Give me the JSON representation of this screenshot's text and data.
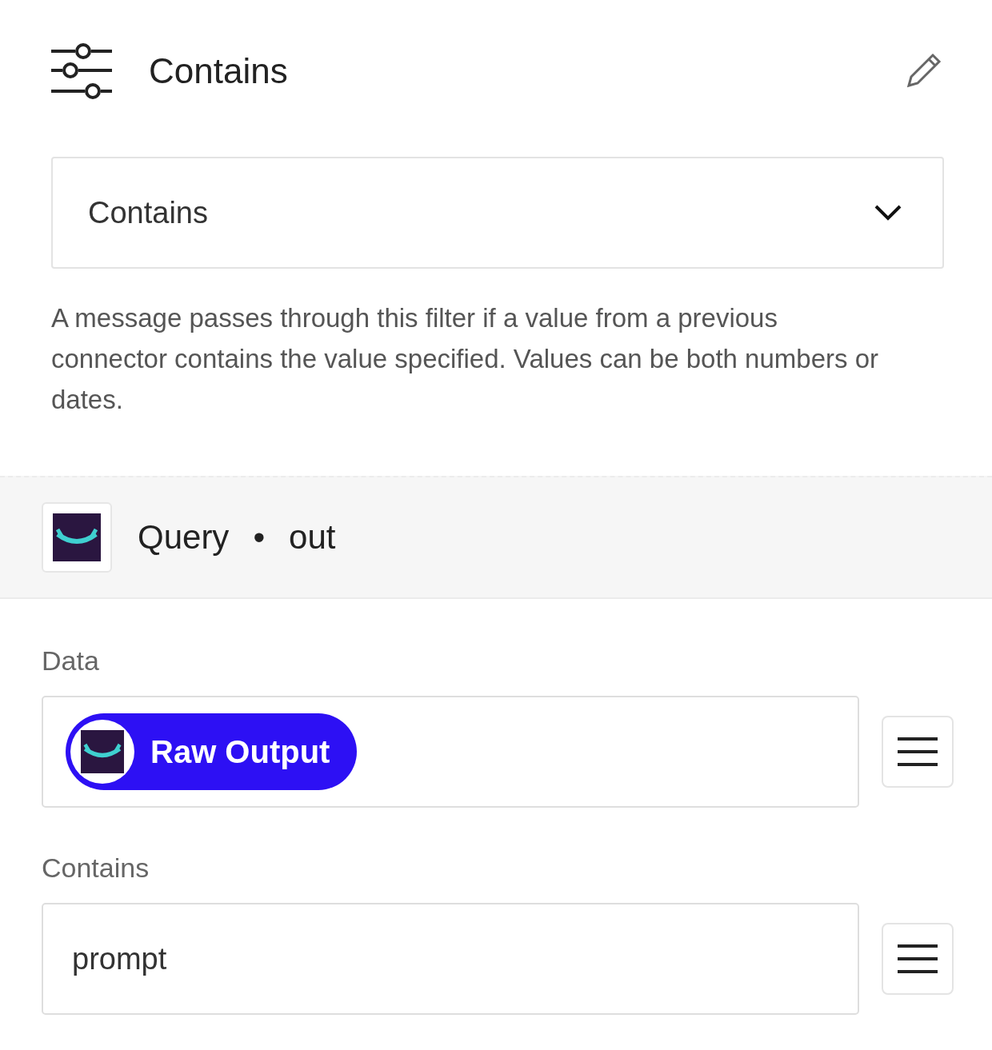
{
  "header": {
    "title": "Contains"
  },
  "operator_select": {
    "value": "Contains"
  },
  "description": "A message passes through this filter if a value from a previous connector contains the value specified. Values can be both numbers or dates.",
  "source": {
    "name": "Query",
    "separator": "•",
    "output": "out"
  },
  "fields": [
    {
      "label": "Data",
      "kind": "chip",
      "value": "Raw Output"
    },
    {
      "label": "Contains",
      "kind": "text",
      "value": "prompt"
    }
  ]
}
